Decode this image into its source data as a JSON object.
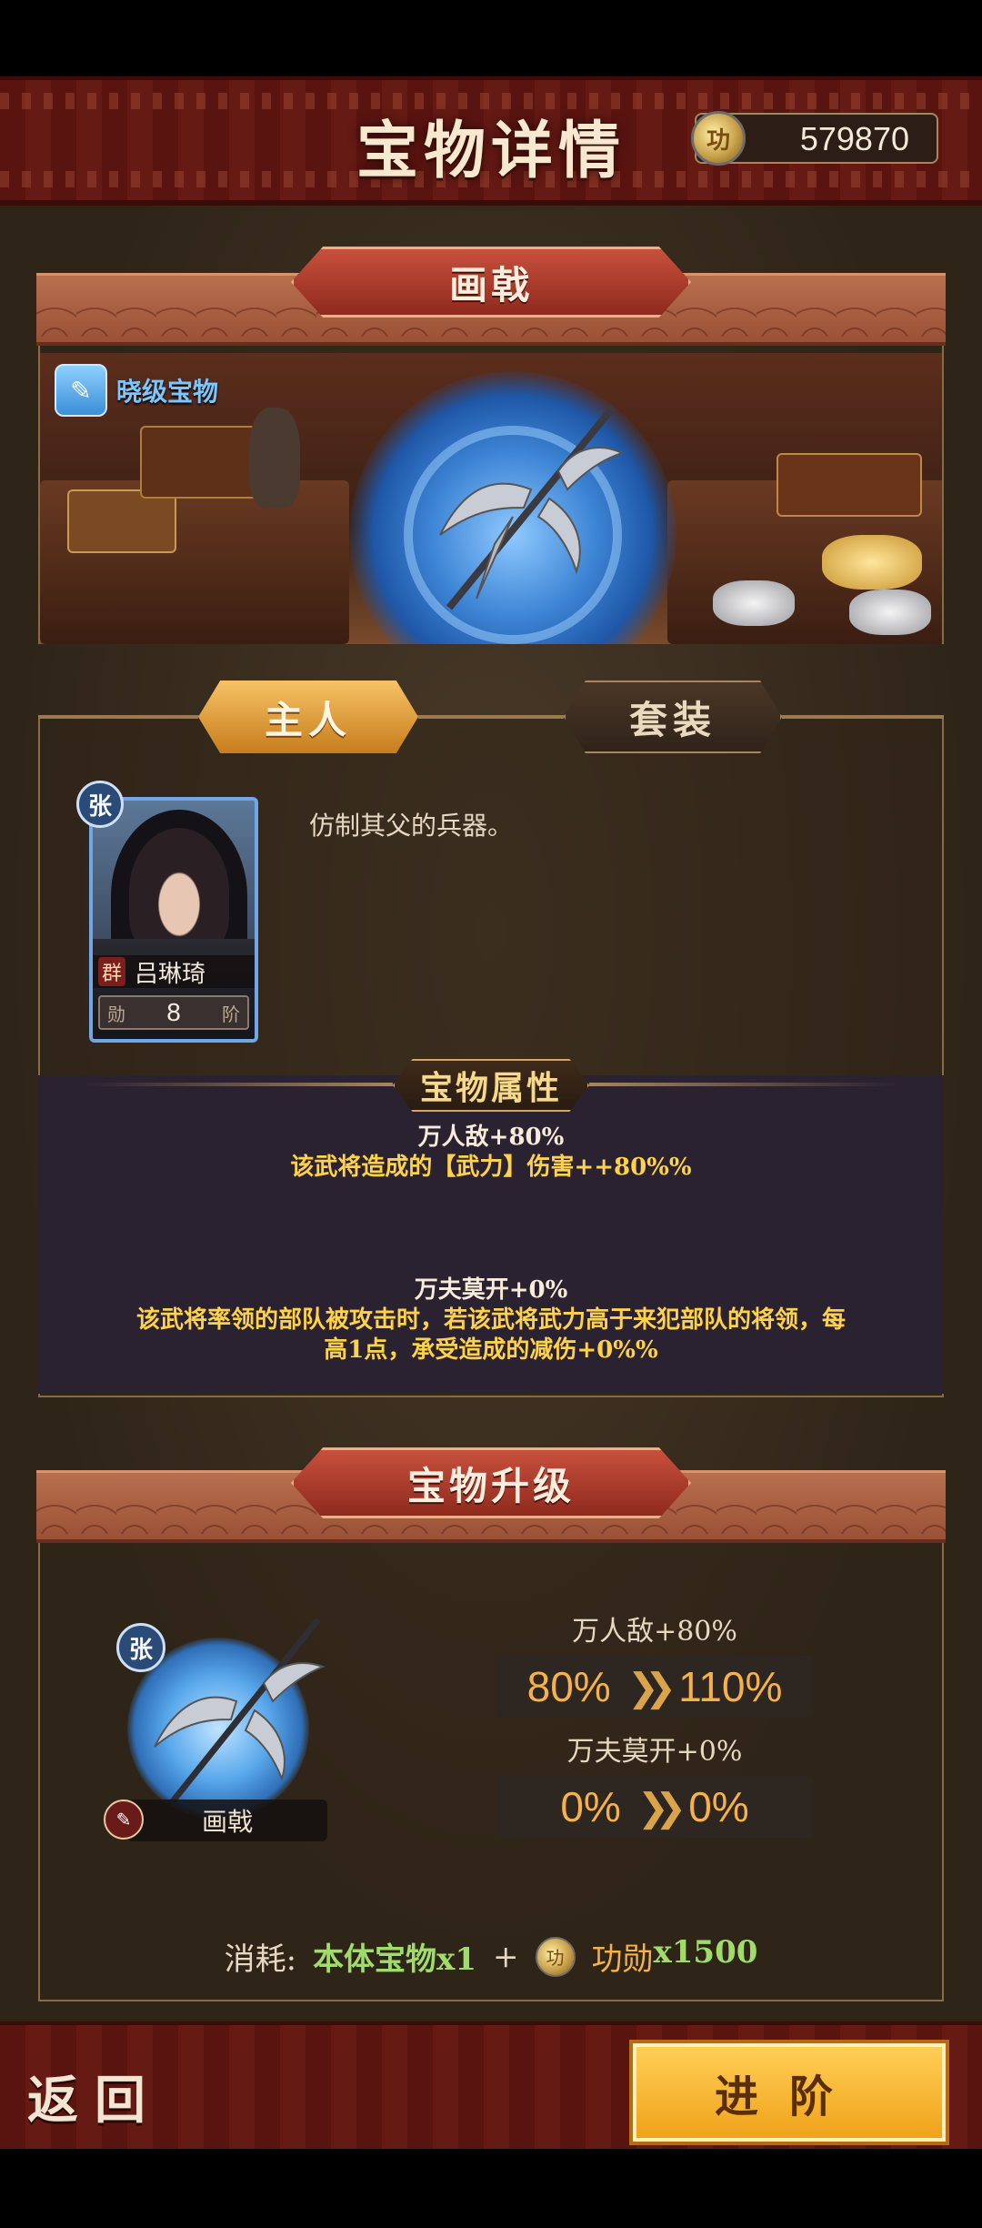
{
  "header": {
    "title": "宝物详情",
    "currency_value": "579870",
    "currency_icon": "merit-coin-icon"
  },
  "treasure": {
    "name": "画戟",
    "grade_label": "晓级宝物"
  },
  "tabs": [
    {
      "label": "主人",
      "active": true
    },
    {
      "label": "套装",
      "active": false
    }
  ],
  "owner": {
    "name": "吕琳琦",
    "faction": "群",
    "rank_value": "8",
    "rank_left": "勋",
    "rank_right": "阶",
    "badge": "张"
  },
  "description": "仿制其父的兵器。",
  "attributes": {
    "title": "宝物属性",
    "items": [
      {
        "name": "万人敌+80%",
        "effect": "该武将造成的【武力】伤害++80%%"
      },
      {
        "name": "万夫莫开+0%",
        "effect_line1": "该武将率领的部队被攻击时，若该武将武力高于来犯部队的将领，每",
        "effect_line2": "高1点，承受造成的减伤+0%%"
      }
    ]
  },
  "upgrade": {
    "title": "宝物升级",
    "weapon_label": "画戟",
    "badge": "张",
    "stats": [
      {
        "label": "万人敌+80%",
        "from": "80%",
        "to": "110%"
      },
      {
        "label": "万夫莫开+0%",
        "from": "0%",
        "to": "0%"
      }
    ],
    "cost_prefix": "消耗:",
    "cost_item": "本体宝物x1",
    "cost_plus": "+",
    "cost_currency_name": "功勋",
    "cost_currency_amount": "x1500"
  },
  "footer": {
    "back_label": "返回",
    "advance_label": "进阶"
  }
}
